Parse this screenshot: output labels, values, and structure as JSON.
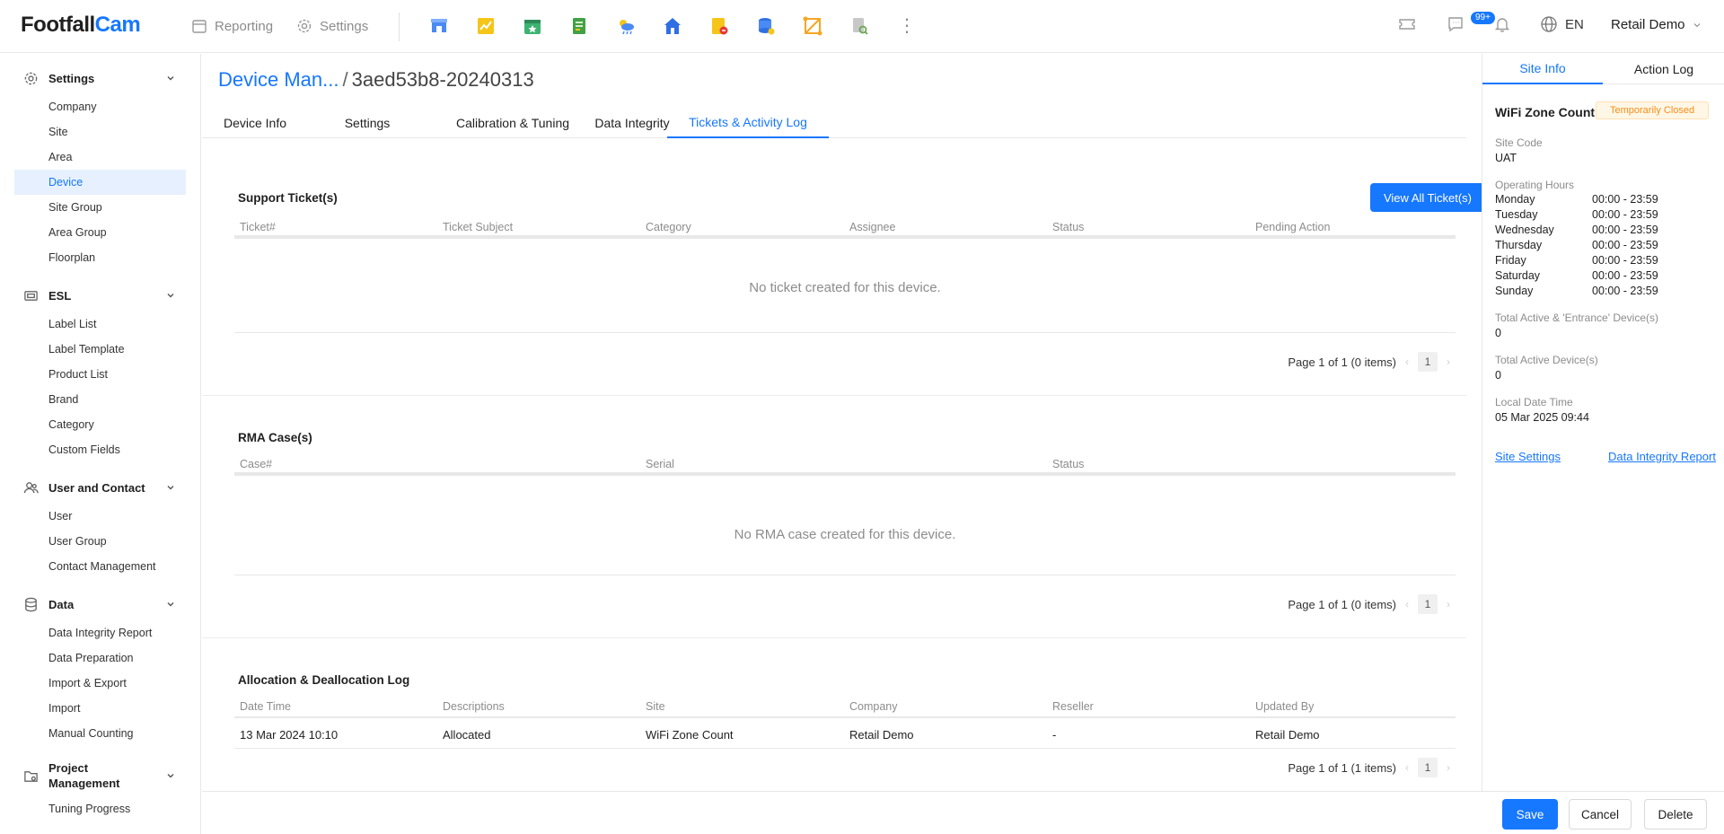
{
  "brand": {
    "part1": "Footfall",
    "part2": "Cam"
  },
  "topbar": {
    "reporting_label": "Reporting",
    "settings_label": "Settings",
    "apps": [
      "retail-icon",
      "chart-icon",
      "calendar-icon",
      "report-icon",
      "weather-icon",
      "home-icon",
      "alert-icon",
      "database-icon",
      "zone-icon",
      "file-search-icon"
    ],
    "notification_count": "99+",
    "language": "EN",
    "user_name": "Retail Demo"
  },
  "sidebar": {
    "groups": [
      {
        "label": "Settings",
        "icon": "gear-icon",
        "items": [
          "Company",
          "Site",
          "Area",
          "Device",
          "Site Group",
          "Area Group",
          "Floorplan"
        ]
      },
      {
        "label": "ESL",
        "icon": "esl-icon",
        "items": [
          "Label List",
          "Label Template",
          "Product List",
          "Brand",
          "Category",
          "Custom Fields"
        ]
      },
      {
        "label": "User and Contact",
        "icon": "users-icon",
        "items": [
          "User",
          "User Group",
          "Contact Management"
        ]
      },
      {
        "label": "Data",
        "icon": "database-icon",
        "items": [
          "Data Integrity Report",
          "Data Preparation",
          "Import & Export",
          "Import",
          "Manual Counting"
        ]
      },
      {
        "label": "Project Management",
        "icon": "folder-gear-icon",
        "items": [
          "Tuning Progress"
        ]
      }
    ],
    "active_item": "Device"
  },
  "page": {
    "breadcrumb": "Device Man...",
    "device_id": "3aed53b8-20240313",
    "tabs": [
      "Device Info",
      "Settings",
      "Calibration & Tuning",
      "Data Integrity",
      "Tickets & Activity Log"
    ],
    "active_tab": "Tickets & Activity Log"
  },
  "support": {
    "title": "Support Ticket(s)",
    "view_all_label": "View All Ticket(s)",
    "columns": [
      "Ticket#",
      "Ticket Subject",
      "Category",
      "Assignee",
      "Status",
      "Pending Action"
    ],
    "empty_text": "No ticket created for this device.",
    "pager_text": "Page 1 of 1 (0 items)",
    "page": "1"
  },
  "rma": {
    "title": "RMA Case(s)",
    "columns": [
      "Case#",
      "Serial",
      "Status"
    ],
    "empty_text": "No RMA case created for this device.",
    "pager_text": "Page 1 of 1 (0 items)",
    "page": "1"
  },
  "allocation": {
    "title": "Allocation & Deallocation Log",
    "columns": [
      "Date Time",
      "Descriptions",
      "Site",
      "Company",
      "Reseller",
      "Updated By"
    ],
    "rows": [
      [
        "13 Mar 2024 10:10",
        "Allocated",
        "WiFi Zone Count",
        "Retail Demo",
        "-",
        "Retail Demo"
      ]
    ],
    "pager_text": "Page 1 of 1 (1 items)",
    "page": "1"
  },
  "actions": {
    "save": "Save",
    "cancel": "Cancel",
    "delete": "Delete"
  },
  "right_panel": {
    "tabs": [
      "Site Info",
      "Action Log"
    ],
    "active_tab": "Site Info",
    "site_name": "WiFi Zone Count",
    "status_badge": "Temporarily Closed",
    "site_code_label": "Site Code",
    "site_code": "UAT",
    "operating_hours_label": "Operating Hours",
    "hours": [
      {
        "day": "Monday",
        "time": "00:00 - 23:59"
      },
      {
        "day": "Tuesday",
        "time": "00:00 - 23:59"
      },
      {
        "day": "Wednesday",
        "time": "00:00 - 23:59"
      },
      {
        "day": "Thursday",
        "time": "00:00 - 23:59"
      },
      {
        "day": "Friday",
        "time": "00:00 - 23:59"
      },
      {
        "day": "Saturday",
        "time": "00:00 - 23:59"
      },
      {
        "day": "Sunday",
        "time": "00:00 - 23:59"
      }
    ],
    "entrance_devices_label": "Total Active & 'Entrance' Device(s)",
    "entrance_devices": "0",
    "active_devices_label": "Total Active Device(s)",
    "active_devices": "0",
    "local_time_label": "Local Date Time",
    "local_time": "05 Mar 2025 09:44",
    "site_settings_link": "Site Settings",
    "data_integrity_link": "Data Integrity Report"
  },
  "colors": {
    "accent": "#1677ff",
    "warning": "#fa8c16"
  }
}
